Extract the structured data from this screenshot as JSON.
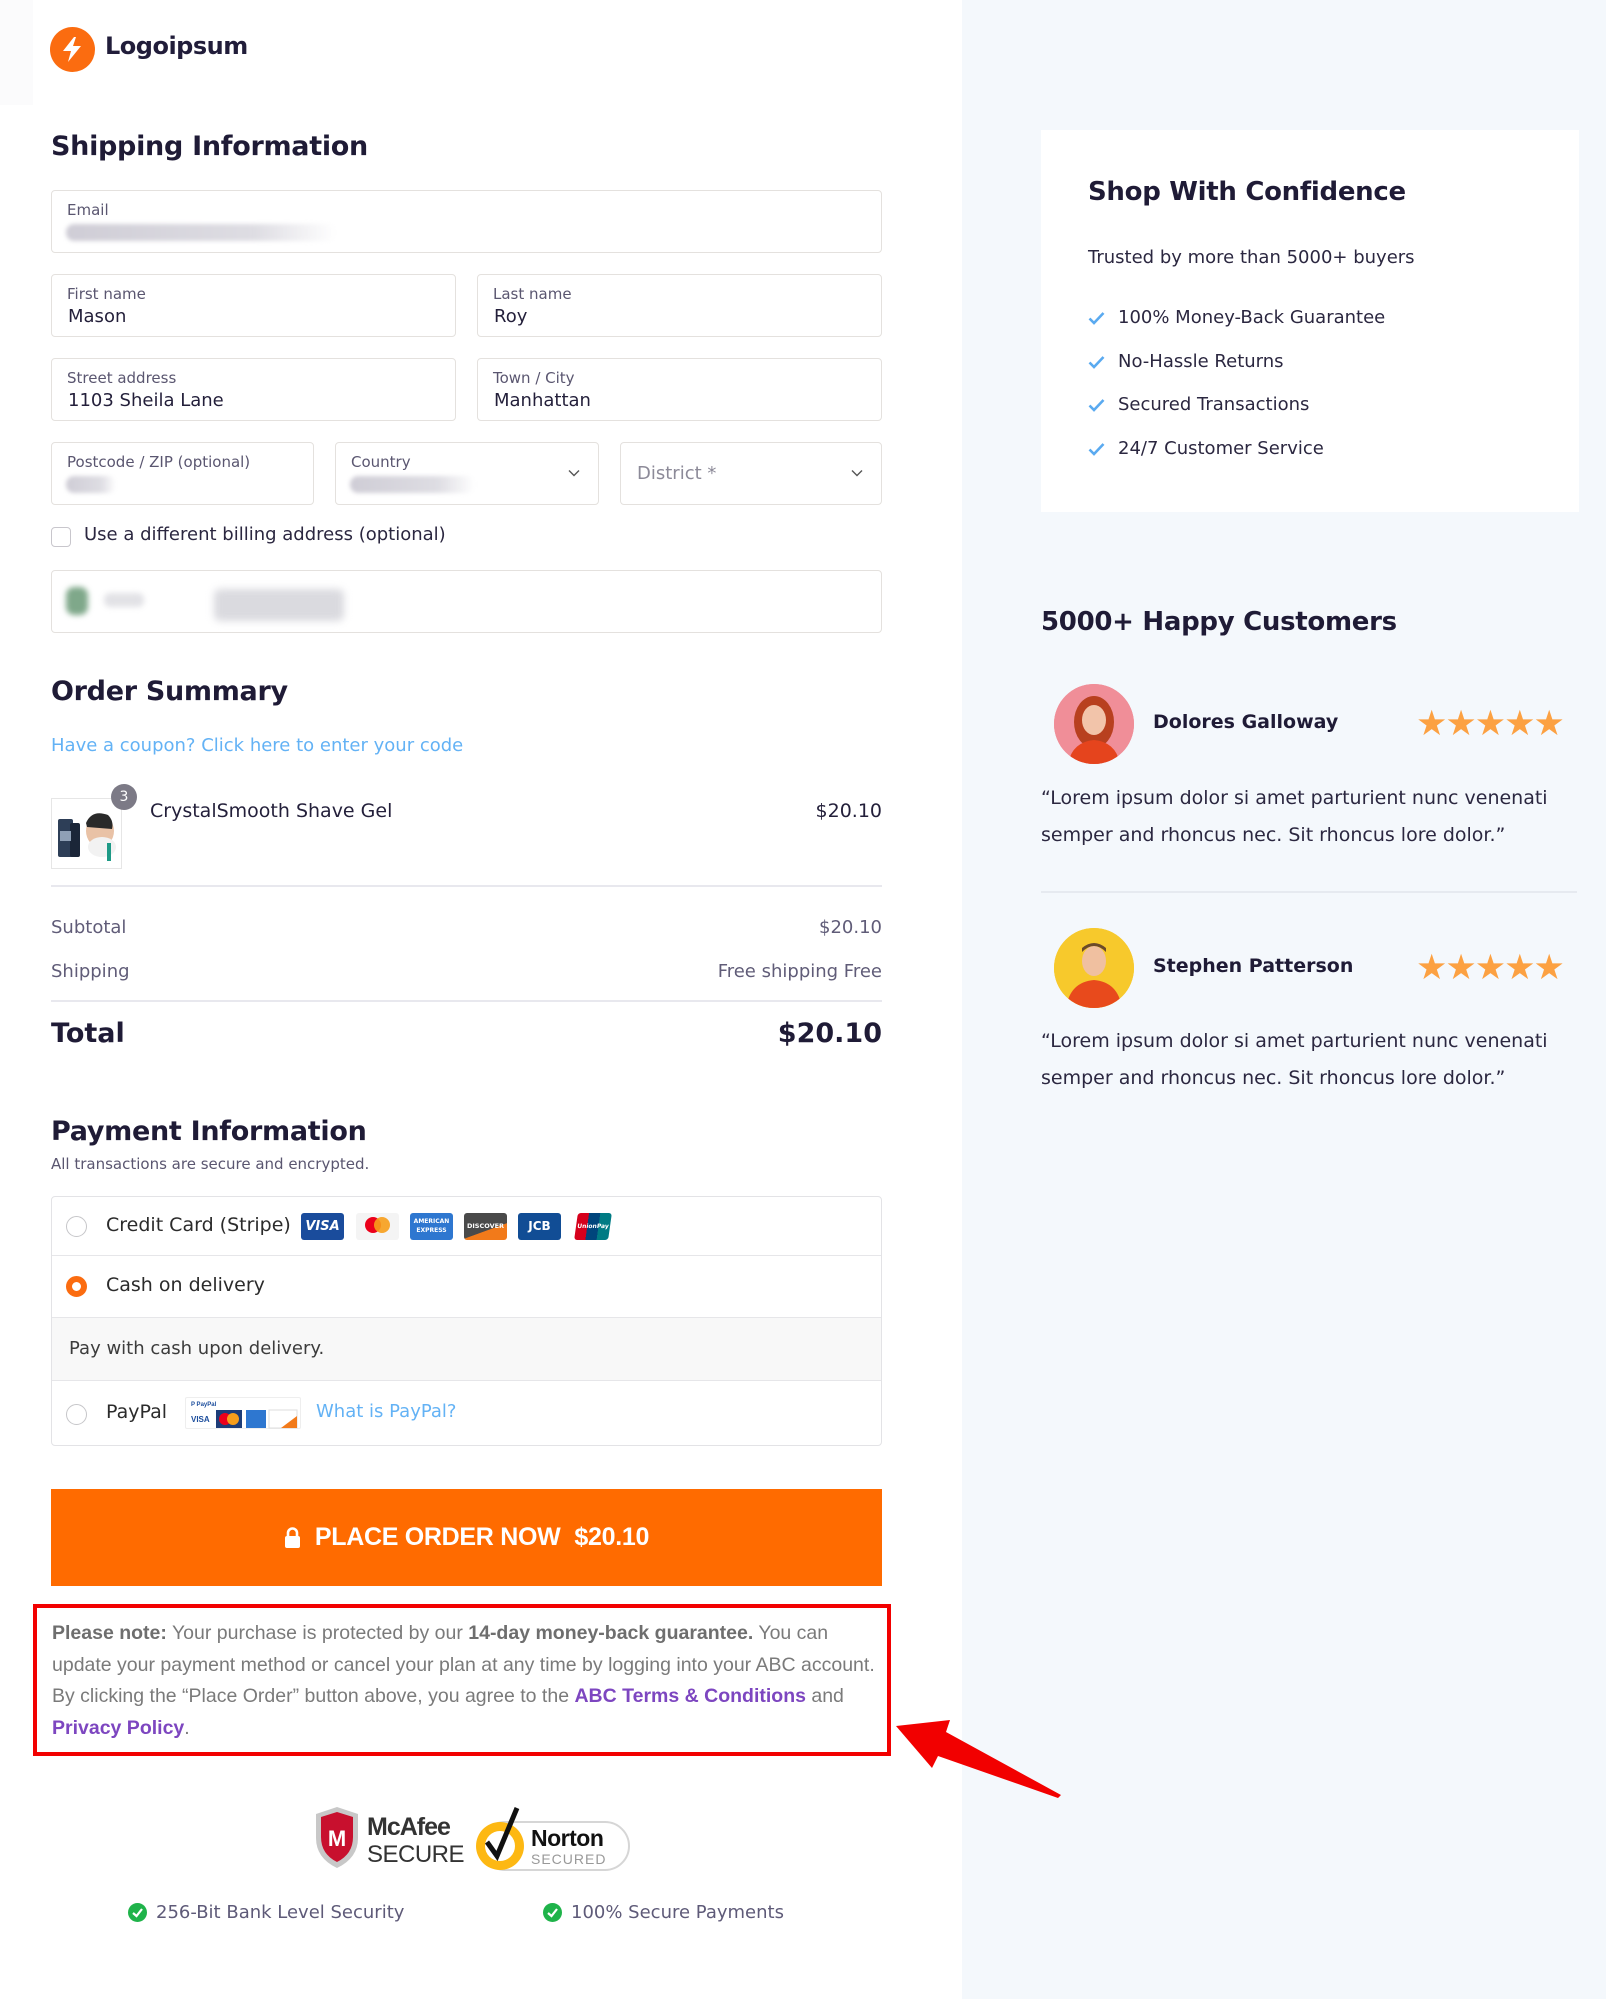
{
  "brand": {
    "name": "Logoipsum",
    "accent_color": "#FF6B00"
  },
  "shipping": {
    "title": "Shipping Information",
    "fields": {
      "email": {
        "label": "Email",
        "value": ""
      },
      "first_name": {
        "label": "First name",
        "value": "Mason"
      },
      "last_name": {
        "label": "Last name",
        "value": "Roy"
      },
      "street": {
        "label": "Street address",
        "value": "1103 Sheila Lane"
      },
      "city": {
        "label": "Town / City",
        "value": "Manhattan"
      },
      "postcode": {
        "label": "Postcode / ZIP (optional)",
        "value": ""
      },
      "country": {
        "label": "Country",
        "value": ""
      },
      "district": {
        "placeholder": "District *"
      }
    },
    "billing_checkbox": {
      "label": "Use a different billing address (optional)",
      "checked": false
    }
  },
  "order_summary": {
    "title": "Order Summary",
    "coupon_link": "Have a coupon? Click here to enter your code",
    "items": [
      {
        "name": "CrystalSmooth Shave Gel",
        "quantity": "3",
        "price": "$20.10"
      }
    ],
    "subtotal_label": "Subtotal",
    "subtotal_value": "$20.10",
    "shipping_label": "Shipping",
    "shipping_value": "Free shipping Free",
    "total_label": "Total",
    "total_value": "$20.10"
  },
  "payment": {
    "title": "Payment Information",
    "subtitle": "All transactions are secure and encrypted.",
    "methods": [
      {
        "label": "Credit Card (Stripe)",
        "selected": false,
        "card_icons": [
          "visa-icon",
          "mastercard-icon",
          "amex-icon",
          "discover-icon",
          "jcb-icon",
          "unionpay-icon"
        ]
      },
      {
        "label": "Cash on delivery",
        "selected": true,
        "description": "Pay with cash upon delivery."
      },
      {
        "label": "PayPal",
        "selected": false,
        "link": "What is PayPal?"
      }
    ],
    "card_labels": {
      "visa": "VISA",
      "amex": "AMERICAN EXPRESS",
      "discover": "DISCOVER",
      "jcb": "JCB",
      "unionpay": "UnionPay"
    }
  },
  "place_order": {
    "label": "PLACE ORDER NOW",
    "amount": "$20.10"
  },
  "notice": {
    "lead": "Please note:",
    "text1": " Your purchase is protected by our ",
    "bold": "14-day money-back guarantee.",
    "text2": " You can update your payment method or cancel your plan at any time by logging into your ABC account. By clicking the “Place Order” button above, you agree to the ",
    "terms_link": "ABC Terms & Conditions",
    "and": " and ",
    "privacy_link": "Privacy Policy",
    "end": "."
  },
  "security_badges": {
    "mcafee": {
      "line1": "McAfee",
      "line2": "SECURE"
    },
    "norton": {
      "line1": "Norton",
      "line2": "SECURED"
    }
  },
  "trust_lines": [
    "256-Bit Bank Level Security",
    "100% Secure Payments"
  ],
  "confidence": {
    "title": "Shop With Confidence",
    "subtitle": "Trusted by more than 5000+ buyers",
    "items": [
      "100% Money-Back Guarantee",
      "No-Hassle Returns",
      "Secured Transactions",
      "24/7 Customer Service"
    ]
  },
  "reviews": {
    "title": "5000+ Happy Customers",
    "items": [
      {
        "name": "Dolores Galloway",
        "rating": 5,
        "stars": "★★★★★",
        "quote": "“Lorem ipsum dolor si amet parturient nunc venenati semper and rhoncus nec. Sit rhoncus lore dolor.”"
      },
      {
        "name": "Stephen Patterson",
        "rating": 5,
        "stars": "★★★★★",
        "quote": "“Lorem ipsum dolor si amet parturient nunc venenati semper and rhoncus nec. Sit rhoncus lore dolor.”"
      }
    ]
  }
}
